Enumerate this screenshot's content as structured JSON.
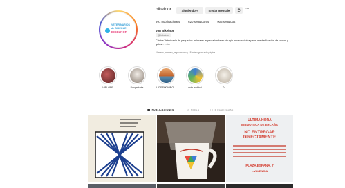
{
  "profile": {
    "username": "bikelnor",
    "following_label": "Siguiendo ˅",
    "message_label": "Enviar mensaje",
    "person_icon": "add-person-icon",
    "more_icon": "ellipsis-icon",
    "more_symbol": "···",
    "stats": {
      "posts": "991 publicaciones",
      "followers": "620 seguidores",
      "following": "906 seguidos"
    },
    "bio": {
      "name": "Jon Bikelnor",
      "badge": "@ bikelnor",
      "description": "Clínica Veterinaria de pequeños animales especializada en cirugía laparoscópica para la esterilización de perros y gatos...",
      "more": "más",
      "followed_by": "Ulimana, marcelo_regnomuerto y 18 más siguen esta página"
    },
    "avatar_logo": {
      "line1": "VETERINARIOS",
      "line2": "de BIDEGUE",
      "line3": "BIKELNOR"
    }
  },
  "highlights": [
    {
      "label": "VIRLOPE",
      "color": "#8b3a3a"
    },
    {
      "label": "Despertarte",
      "color": "#d8cfc6"
    },
    {
      "label": "LATESHOWRO...",
      "color": "#d07a3f"
    },
    {
      "label": "este auditori",
      "color": "#3f7fd0"
    },
    {
      "label": "T4",
      "color": "#e6e1d8"
    }
  ],
  "tabs": [
    {
      "label": "PUBLICACIONES",
      "icon": "grid-icon",
      "symbol": "▦"
    },
    {
      "label": "REELS",
      "icon": "reels-icon",
      "symbol": "▷"
    },
    {
      "label": "ETIQUETADAS",
      "icon": "tagged-icon",
      "symbol": "◫"
    }
  ],
  "posts": {
    "post3_lines": [
      "ULTIMA HORA",
      "BIBLIOTECA DE ERCAÑA",
      "NO ENTREGAR",
      "DIRECTAMENTE",
      "PLAZA ESPAÑA, 7",
      "...VALENCIA"
    ]
  }
}
